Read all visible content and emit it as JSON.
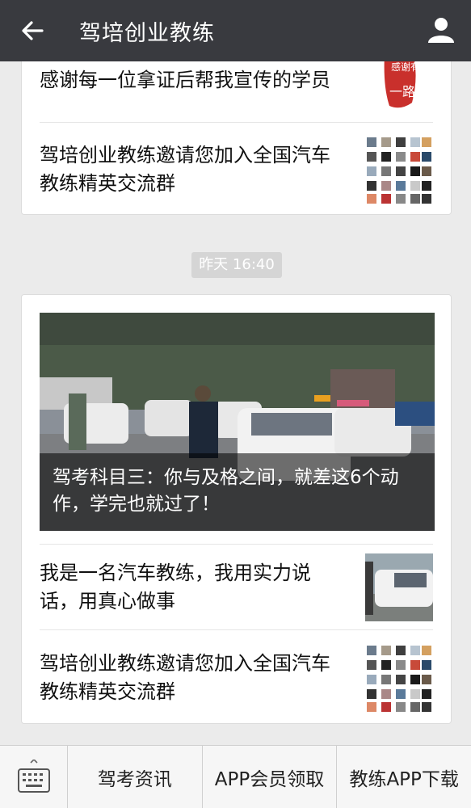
{
  "header": {
    "back_icon": "back-arrow-icon",
    "title": "驾培创业教练",
    "profile_icon": "person-icon"
  },
  "feed": {
    "card1": {
      "items": [
        {
          "title": "感谢每一位拿证后帮我宣传的学员",
          "thumb_text": "感谢有你"
        },
        {
          "title": "驾培创业教练邀请您加入全国汽车教练精英交流群"
        }
      ]
    },
    "timestamp": "昨天 16:40",
    "card2": {
      "hero_title": "驾考科目三：你与及格之间，就差这6个动作，学完也就过了！",
      "items": [
        {
          "title": "我是一名汽车教练，我用实力说话，用真心做事"
        },
        {
          "title": "驾培创业教练邀请您加入全国汽车教练精英交流群"
        }
      ]
    }
  },
  "bottom_menu": {
    "keyboard_icon": "keyboard-icon",
    "items": [
      {
        "label": "驾考资讯"
      },
      {
        "label": "APP会员领取"
      },
      {
        "label": "教练APP下载"
      }
    ]
  },
  "colors": {
    "header_bg": "#393a3f",
    "page_bg": "#ebebeb",
    "card_bg": "#ffffff"
  }
}
